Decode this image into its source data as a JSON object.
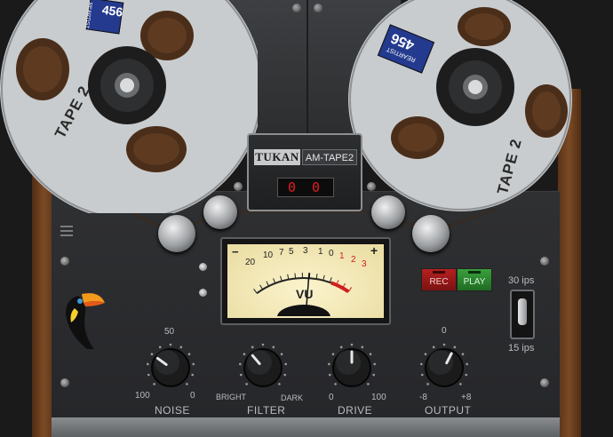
{
  "reels": {
    "left": {
      "reel_label": "TAPE 2",
      "box_brand": "REARTIST",
      "box_model": "456"
    },
    "right": {
      "reel_label": "TAPE 2",
      "box_brand": "REARTIST",
      "box_model": "456"
    }
  },
  "header": {
    "brand": "TUKAN",
    "model": "AM-TAPE2",
    "counter_left": "0",
    "counter_right": "0"
  },
  "vu": {
    "label": "VU",
    "minus": "−",
    "plus": "+",
    "scale_black": [
      "20",
      "10",
      "7",
      "5",
      "3",
      "1",
      "0"
    ],
    "scale_red": [
      "1",
      "2",
      "3"
    ],
    "needle_db": -7
  },
  "transport": {
    "rec_label": "REC",
    "play_label": "PLAY"
  },
  "speed": {
    "top_label": "30 ips",
    "bottom_label": "15 ips",
    "selected": "15 ips"
  },
  "knobs": {
    "noise": {
      "label": "NOISE",
      "min": "100",
      "mid": "50",
      "max": "0",
      "value": 0.3
    },
    "filter": {
      "label": "FILTER",
      "min": "BRIGHT",
      "max": "DARK",
      "value": 0.35
    },
    "drive": {
      "label": "DRIVE",
      "min": "0",
      "max": "100",
      "value": 0.5
    },
    "output": {
      "label": "OUTPUT",
      "min": "-8",
      "mid": "0",
      "max": "+8",
      "value": 0.6
    }
  },
  "colors": {
    "panel": "#2b2c2e",
    "wood": "#6b3e1e",
    "vu_face": "#f1e6b4",
    "rec": "#a11c1c",
    "play": "#2e8a32",
    "counter_digits": "#e02020"
  }
}
